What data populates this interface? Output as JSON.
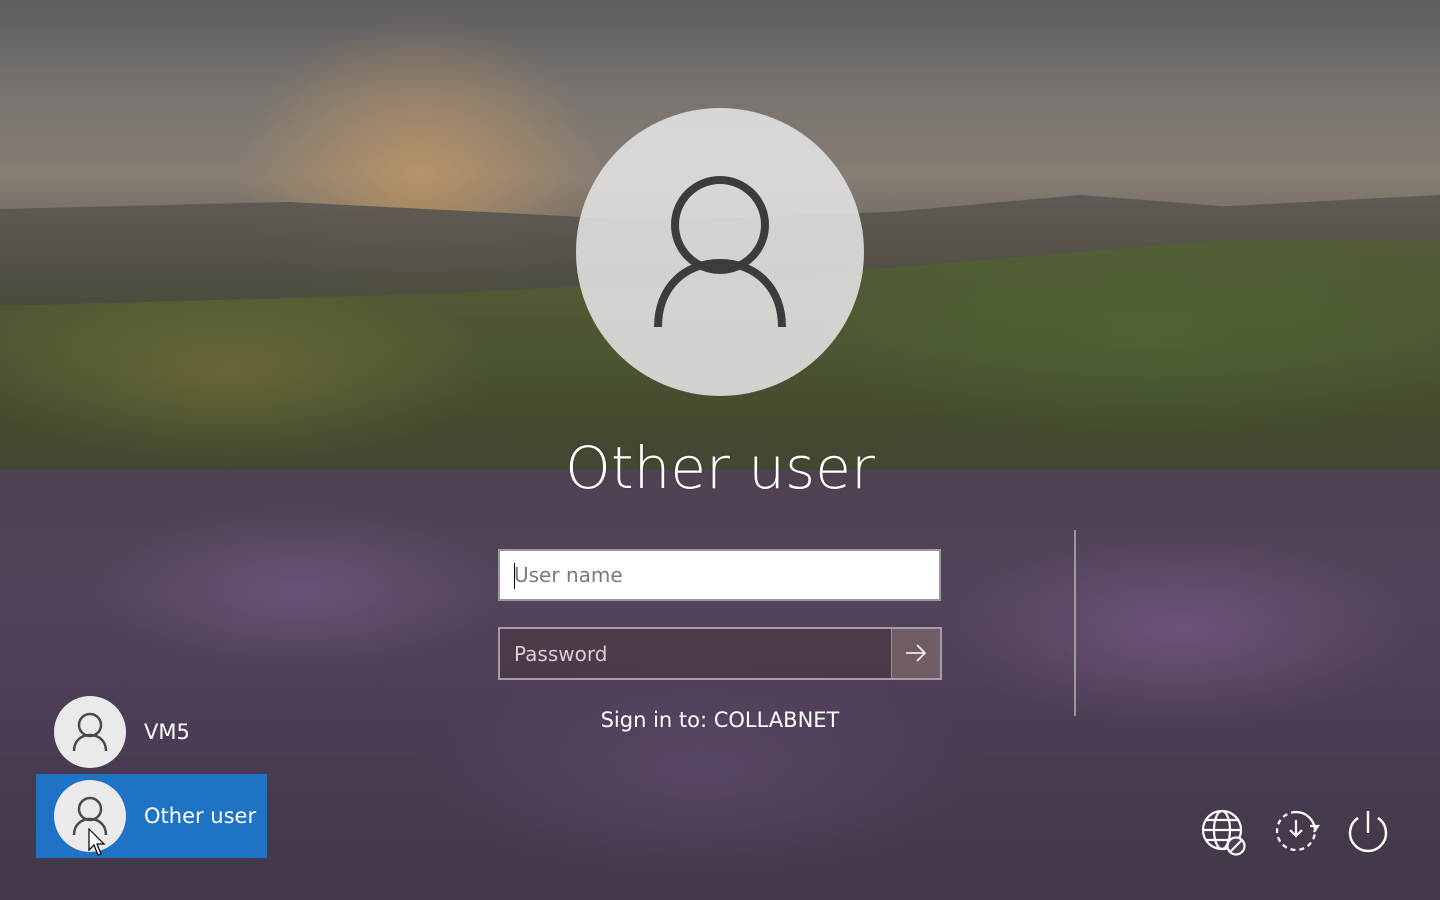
{
  "login": {
    "title": "Other user",
    "username_placeholder": "User name",
    "username_value": "",
    "password_placeholder": "Password",
    "password_value": "",
    "submit_icon": "arrow-right-icon",
    "sign_in_to": "Sign in to: COLLABNET"
  },
  "users": [
    {
      "label": "VM5",
      "icon": "user-avatar-icon",
      "selected": false
    },
    {
      "label": "Other user",
      "icon": "user-avatar-icon",
      "selected": true
    }
  ],
  "system_buttons": [
    {
      "name": "network",
      "icon": "globe-disconnected-icon"
    },
    {
      "name": "accessibility",
      "icon": "ease-of-access-icon"
    },
    {
      "name": "power",
      "icon": "power-icon"
    }
  ],
  "colors": {
    "selected_tile": "#1f73c5",
    "avatar_bg": "#e4e4e4",
    "text": "#ffffff"
  }
}
